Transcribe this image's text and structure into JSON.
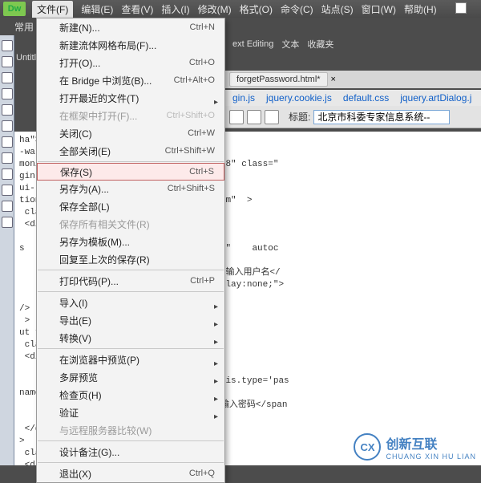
{
  "menubar": {
    "items": [
      "文件(F)",
      "编辑(E)",
      "查看(V)",
      "插入(I)",
      "修改(M)",
      "格式(O)",
      "命令(C)",
      "站点(S)",
      "窗口(W)",
      "帮助(H)"
    ]
  },
  "toolbar": {
    "label": "常用"
  },
  "tabs_secondary": [
    "ext Editing",
    "文本",
    "收藏夹"
  ],
  "doc_tabs": [
    "forgetPassword.html*"
  ],
  "sub_files": [
    "gin.js",
    "jquery.cookie.js",
    "default.css",
    "jquery.artDialog.j"
  ],
  "title_label": "标题:",
  "title_value": "北京市科委专家信息系统--",
  "untitled": "Untitl",
  "menu_file": [
    {
      "label": "新建(N)...",
      "sc": "Ctrl+N"
    },
    {
      "label": "新建流体网格布局(F)...",
      "sc": ""
    },
    {
      "label": "打开(O)...",
      "sc": "Ctrl+O"
    },
    {
      "label": "在 Bridge 中浏览(B)...",
      "sc": "Ctrl+Alt+O"
    },
    {
      "label": "打开最近的文件(T)",
      "sc": "",
      "sub": true
    },
    {
      "label": "在框架中打开(F)...",
      "sc": "Ctrl+Shift+O",
      "disabled": true
    },
    {
      "label": "关闭(C)",
      "sc": "Ctrl+W"
    },
    {
      "label": "全部关闭(E)",
      "sc": "Ctrl+Shift+W"
    },
    {
      "sep": true
    },
    {
      "label": "保存(S)",
      "sc": "Ctrl+S",
      "hl": true
    },
    {
      "label": "另存为(A)...",
      "sc": "Ctrl+Shift+S"
    },
    {
      "label": "保存全部(L)",
      "sc": ""
    },
    {
      "label": "保存所有相关文件(R)",
      "sc": "",
      "disabled": true
    },
    {
      "label": "另存为模板(M)...",
      "sc": ""
    },
    {
      "label": "回复至上次的保存(R)",
      "sc": ""
    },
    {
      "sep": true
    },
    {
      "label": "打印代码(P)...",
      "sc": "Ctrl+P"
    },
    {
      "sep": true
    },
    {
      "label": "导入(I)",
      "sc": "",
      "sub": true
    },
    {
      "label": "导出(E)",
      "sc": "",
      "sub": true
    },
    {
      "label": "转换(V)",
      "sc": "",
      "sub": true
    },
    {
      "sep": true
    },
    {
      "label": "在浏览器中预览(P)",
      "sc": "",
      "sub": true
    },
    {
      "label": "多屏预览",
      "sc": "",
      "sub": true
    },
    {
      "label": "检查页(H)",
      "sc": "",
      "sub": true
    },
    {
      "label": "验证",
      "sc": "",
      "sub": true
    },
    {
      "label": "与远程服务器比较(W)",
      "sc": "",
      "disabled": true
    },
    {
      "sep": true
    },
    {
      "label": "设计备注(G)...",
      "sc": ""
    },
    {
      "sep": true
    },
    {
      "label": "退出(X)",
      "sc": "Ctrl+Q"
    }
  ],
  "code": "ha\">\n-warp\">\nmon/login/cl.jpg\" width=\"138\" height=\"48\" class=\"\ngin-main\">\nui-login-body\">\ntion=\"\"  method=\"post\" id=\"ui-login-form\"  >\n class=\"ui-login-list\">\n <div class=\"ui-login-panel\">\n     <div class=\"ui-login-box\">\ns       <input type=\"text\" name=\"userId\"    autoc\n\n         <span class=\"ui-login-label\"> 输入用户名</\n         <ul id=\"auto-list\" style=\"display:none;\">\n     </ul></div>\n/>\n >\nut type=\"text\" style=\"display: none;\"/>\n class=\"ui-login-list\">\n <div class=\"ui-login-panel\">\n     <div class=\"ui-login-box\">\n         <input type=\"text\" onfocus=\"this.type='pas\nname=\"密码\"  />\n         <span class=\"ui-login-label\">输入密码</span\n     </div>\n </div>\n>\n class=\"ui-login-list\">\n <div class=\"ui-login-panel\">\n     <div class=\"ui-login-box\">\n         <input type=\"text\"",
  "watermark": {
    "text": "创新互联",
    "sub": "CHUANG XIN HU LIAN",
    "logo": "CX"
  }
}
